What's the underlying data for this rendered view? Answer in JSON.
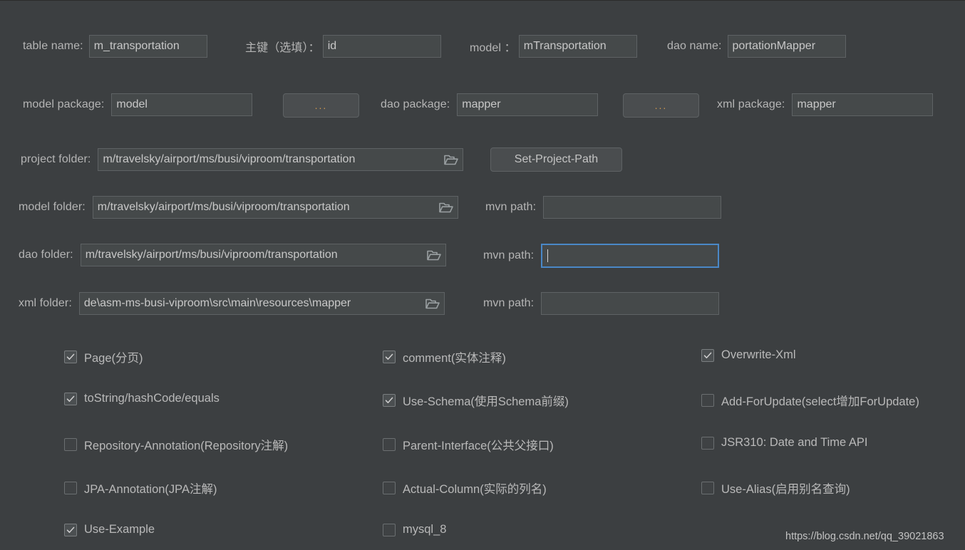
{
  "top_row": {
    "table_name": {
      "label": "table  name:",
      "value": "m_transportation"
    },
    "primary_key": {
      "label": "主键（选填）：",
      "value": "id"
    },
    "model": {
      "label": "model  ：",
      "value": "mTransportation"
    },
    "dao_name": {
      "label": "dao name:",
      "value": "portationMapper"
    }
  },
  "package_row": {
    "model_package": {
      "label": "model package:",
      "value": "model"
    },
    "model_browse": {
      "label": "..."
    },
    "dao_package": {
      "label": "dao package:",
      "value": "mapper"
    },
    "dao_browse": {
      "label": "..."
    },
    "xml_package": {
      "label": "xml package:",
      "value": "mapper"
    }
  },
  "folders": {
    "project": {
      "label": "project folder:",
      "value": "m/travelsky/airport/ms/busi/viproom/transportation",
      "icon": "folder-icon",
      "button": "Set-Project-Path"
    },
    "model": {
      "label": "model  folder:",
      "value": "m/travelsky/airport/ms/busi/viproom/transportation",
      "icon": "folder-icon",
      "mvn_label": "mvn path:",
      "mvn_value": ""
    },
    "dao": {
      "label": "dao    folder:",
      "value": "m/travelsky/airport/ms/busi/viproom/transportation",
      "icon": "folder-icon",
      "mvn_label": "mvn path:",
      "mvn_value": "",
      "mvn_focused": true
    },
    "xml": {
      "label": "xml    folder:",
      "value": "de\\asm-ms-busi-viproom\\src\\main\\resources\\mapper",
      "icon": "folder-icon",
      "mvn_label": "mvn path:",
      "mvn_value": ""
    }
  },
  "checkboxes": {
    "col1": [
      {
        "label": "Page(分页)",
        "checked": true
      },
      {
        "label": "toString/hashCode/equals",
        "checked": true
      },
      {
        "label": "Repository-Annotation(Repository注解)",
        "checked": false
      },
      {
        "label": "JPA-Annotation(JPA注解)",
        "checked": false
      },
      {
        "label": "Use-Example",
        "checked": true
      }
    ],
    "col2": [
      {
        "label": "comment(实体注释)",
        "checked": true
      },
      {
        "label": "Use-Schema(使用Schema前缀)",
        "checked": true
      },
      {
        "label": "Parent-Interface(公共父接口)",
        "checked": false
      },
      {
        "label": "Actual-Column(实际的列名)",
        "checked": false
      },
      {
        "label": "mysql_8",
        "checked": false
      }
    ],
    "col3": [
      {
        "label": "Overwrite-Xml",
        "checked": true
      },
      {
        "label": "Add-ForUpdate(select增加ForUpdate)",
        "checked": false
      },
      {
        "label": "JSR310: Date and Time API",
        "checked": false
      },
      {
        "label": "Use-Alias(启用别名查询)",
        "checked": false
      }
    ]
  },
  "watermark": {
    "text": "https://blog.csdn.net/qq_39021863"
  },
  "colors": {
    "background": "#3c3f41",
    "field_bg": "#45494a",
    "field_border": "#5e6264",
    "text": "#b5b5b5",
    "focus_border": "#4a88c7",
    "accent_dots": "#d2994f"
  }
}
